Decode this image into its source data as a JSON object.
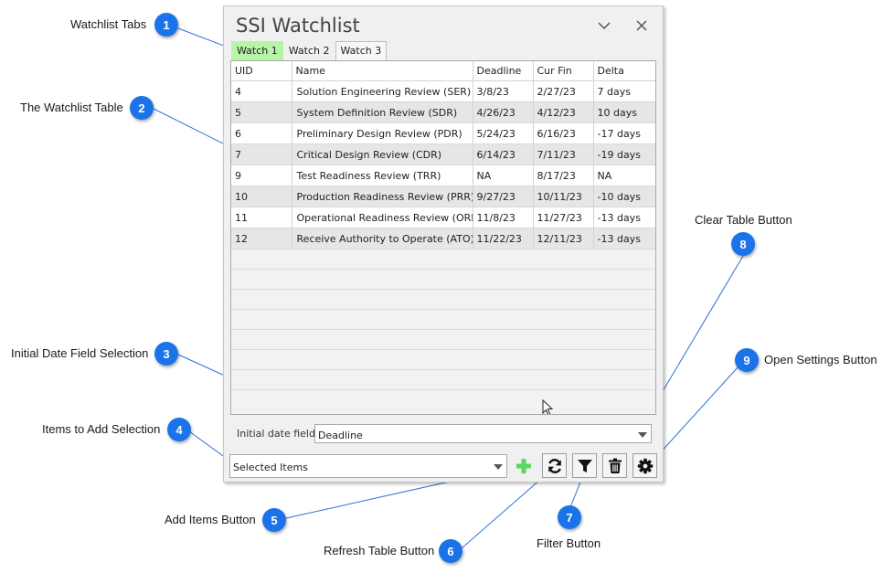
{
  "window": {
    "title": "SSI Watchlist"
  },
  "tabs": [
    "Watch 1",
    "Watch 2",
    "Watch 3"
  ],
  "table": {
    "headers": [
      "UID",
      "Name",
      "Deadline",
      "Cur Fin",
      "Delta"
    ],
    "rows": [
      [
        "4",
        "Solution Engineering Review (SER)",
        "3/8/23",
        "2/27/23",
        "7 days"
      ],
      [
        "5",
        "System Definition Review (SDR)",
        "4/26/23",
        "4/12/23",
        "10 days"
      ],
      [
        "6",
        "Preliminary Design Review (PDR)",
        "5/24/23",
        "6/16/23",
        "-17 days"
      ],
      [
        "7",
        "Critical Design Review (CDR)",
        "6/14/23",
        "7/11/23",
        "-19 days"
      ],
      [
        "9",
        "Test Readiness Review (TRR)",
        "NA",
        "8/17/23",
        "NA"
      ],
      [
        "10",
        "Production Readiness Review (PRR)",
        "9/27/23",
        "10/11/23",
        "-10 days"
      ],
      [
        "11",
        "Operational Readiness Review (ORR)",
        "11/8/23",
        "11/27/23",
        "-13 days"
      ],
      [
        "12",
        "Receive Authority to Operate (ATO)",
        "11/22/23",
        "12/11/23",
        "-13 days"
      ]
    ]
  },
  "initial_date": {
    "label": "Initial date field:",
    "value": "Deadline"
  },
  "items_select": {
    "value": "Selected Items"
  },
  "colors": {
    "active_tab": "#b6f4a8",
    "badge": "#1a73e8",
    "add_icon": "#5cd65c"
  },
  "icons": {
    "minimize": "chevron-down-icon",
    "close": "close-icon",
    "add": "plus-icon",
    "refresh": "refresh-icon",
    "filter": "filter-icon",
    "clear": "trash-icon",
    "settings": "gear-icon"
  },
  "callouts": [
    {
      "num": "1",
      "label": "Watchlist Tabs"
    },
    {
      "num": "2",
      "label": "The Watchlist Table"
    },
    {
      "num": "3",
      "label": "Initial Date Field Selection"
    },
    {
      "num": "4",
      "label": "Items to Add Selection"
    },
    {
      "num": "5",
      "label": "Add Items Button"
    },
    {
      "num": "6",
      "label": "Refresh Table Button"
    },
    {
      "num": "7",
      "label": "Filter Button"
    },
    {
      "num": "8",
      "label": "Clear Table Button"
    },
    {
      "num": "9",
      "label": "Open Settings Button"
    }
  ]
}
